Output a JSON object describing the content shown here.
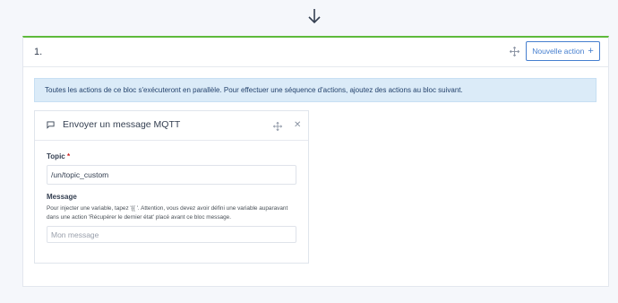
{
  "block": {
    "number": "1.",
    "new_action_label": "Nouvelle action",
    "info_text": "Toutes les actions de ce bloc s'exécuteront en parallèle. Pour effectuer une séquence d'actions, ajoutez des actions au bloc suivant."
  },
  "card": {
    "title": "Envoyer un message MQTT",
    "topic_label": "Topic",
    "required_mark": "*",
    "topic_value": "/un/topic_custom",
    "message_label": "Message",
    "message_help": "Pour injecter une variable, tapez '{{ '. Attention, vous devez avoir défini une variable auparavant dans une action 'Récupérer le dernier état' placé avant ce bloc message.",
    "message_placeholder": "Mon message"
  },
  "icons": {
    "arrow": "arrow-down-icon",
    "move": "move-icon",
    "message": "message-square-icon",
    "close": "close-icon",
    "plus": "plus-icon"
  },
  "colors": {
    "accent_green": "#5eba3b",
    "primary_blue": "#467fcf",
    "info_bg": "#dbebf8"
  }
}
